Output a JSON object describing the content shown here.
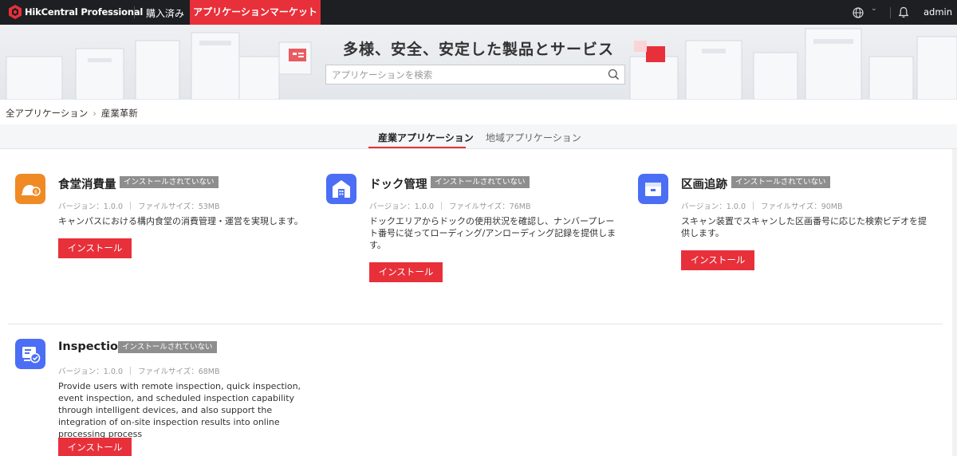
{
  "header": {
    "brand": "HikCentral Professional",
    "nav_purchased": "購入済み",
    "nav_market": "アプリケーションマーケット",
    "language_icon": "globe-icon",
    "notification_icon": "bell-icon",
    "user": "admin"
  },
  "banner": {
    "title": "多様、安全、安定した製品とサービス",
    "search_placeholder": "アプリケーションを検索"
  },
  "breadcrumb": {
    "root": "全アプリケーション",
    "current": "産業革新"
  },
  "tabs": [
    {
      "label": "産業アプリケーション",
      "active": true
    },
    {
      "label": "地域アプリケーション",
      "active": false
    }
  ],
  "apps": [
    {
      "name": "食堂消費量",
      "status": "インストールされていない",
      "version": "バージョン：1.0.0",
      "size": "ファイルサイズ：53MB",
      "description": "キャンパスにおける構内食堂の消費管理・運営を実現します。",
      "button": "インストール",
      "icon": "canteen-icon",
      "icon_color": "#f08a24"
    },
    {
      "name": "ドック管理",
      "status": "インストールされていない",
      "version": "バージョン：1.0.0",
      "size": "ファイルサイズ：76MB",
      "description": "ドックエリアからドックの使用状況を確認し、ナンバープレート番号に従ってローディング/アンローディング記録を提供します。",
      "button": "インストール",
      "icon": "dock-icon",
      "icon_color": "#4b6ef5"
    },
    {
      "name": "区画追跡",
      "status": "インストールされていない",
      "version": "バージョン：1.0.0",
      "size": "ファイルサイズ：90MB",
      "description": "スキャン装置でスキャンした区画番号に応じた検索ビデオを提供します。",
      "button": "インストール",
      "icon": "parcel-icon",
      "icon_color": "#4b6ef5"
    },
    {
      "name": "Inspection",
      "status": "インストールされていない",
      "version": "バージョン：1.0.0",
      "size": "ファイルサイズ：68MB",
      "description": "Provide users with remote inspection, quick inspection, event inspection, and scheduled inspection capability through intelligent devices, and also support the integration of on-site inspection results into online processing process",
      "button": "インストール",
      "icon": "inspection-icon",
      "icon_color": "#4b6ef5"
    }
  ],
  "colors": {
    "accent": "#e8303a",
    "topbar": "#1d1f22",
    "badge": "#8e8e8e"
  }
}
